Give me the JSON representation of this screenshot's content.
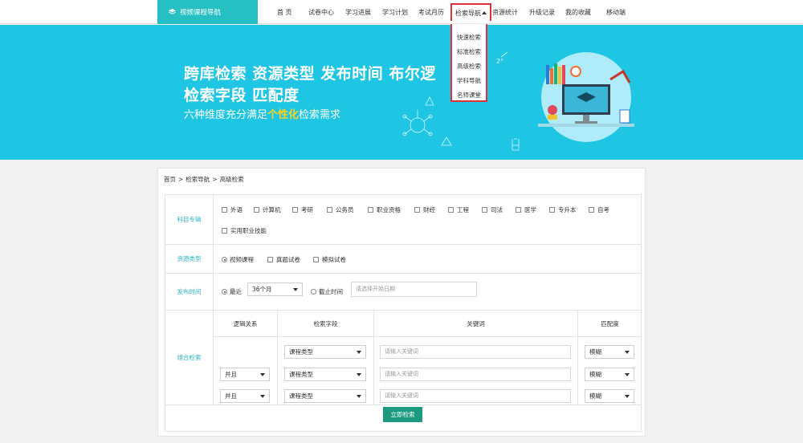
{
  "header": {
    "logo_text": "视频课程导航",
    "nav": [
      "首 页",
      "试卷中心",
      "学习进展",
      "学习计划",
      "考试月历",
      "检索导航",
      "资源统计",
      "升级记录",
      "我的收藏",
      "移动端"
    ],
    "active_nav": "检索导航",
    "dropdown": [
      "快速检索",
      "标准检索",
      "高级检索",
      "学科导航",
      "名师课堂"
    ]
  },
  "banner": {
    "line1": "跨库检索 资源类型 发布时间 布尔逻",
    "line2": "检索字段 匹配度",
    "line3_pre": "六种维度充分满足",
    "line3_hl": "个性化",
    "line3_post": "检索需求",
    "decor_text": "2°"
  },
  "breadcrumb": [
    "首页",
    "检索导航",
    "高级检索"
  ],
  "form": {
    "subject": {
      "label": "科目专辑",
      "options": [
        "外语",
        "计算机",
        "考研",
        "公务员",
        "职业资格",
        "财经",
        "工程",
        "司法",
        "医学",
        "专升本",
        "自考",
        "实用职业技能"
      ]
    },
    "resource": {
      "label": "资源类型",
      "options": [
        "视频课程",
        "真题试卷",
        "模拟试卷"
      ],
      "selected": "视频课程"
    },
    "publish": {
      "label": "发布时间",
      "recent_label": "最近",
      "recent_value": "36个月",
      "until_label": "截止时间",
      "date_placeholder": "请选择开始日期",
      "selected": "最近"
    },
    "combo": {
      "label": "组合检索",
      "headers": [
        "逻辑关系",
        "检索字段",
        "关键词",
        "匹配度"
      ],
      "rows": [
        {
          "logic": "",
          "field": "课程类型",
          "keyword_placeholder": "请输入关键词",
          "match": "模糊"
        },
        {
          "logic": "并且",
          "field": "课程类型",
          "keyword_placeholder": "请输入关键词",
          "match": "模糊"
        },
        {
          "logic": "并且",
          "field": "课程类型",
          "keyword_placeholder": "请输入关键词",
          "match": "模糊"
        }
      ]
    },
    "submit_label": "立即检索"
  },
  "colors": {
    "brand": "#26bfc4",
    "banner": "#1fc6e3",
    "accent_label": "#29b5c0",
    "button": "#1b9a7f",
    "highlight": "#e0323c",
    "emphasis": "#ffd21a"
  }
}
